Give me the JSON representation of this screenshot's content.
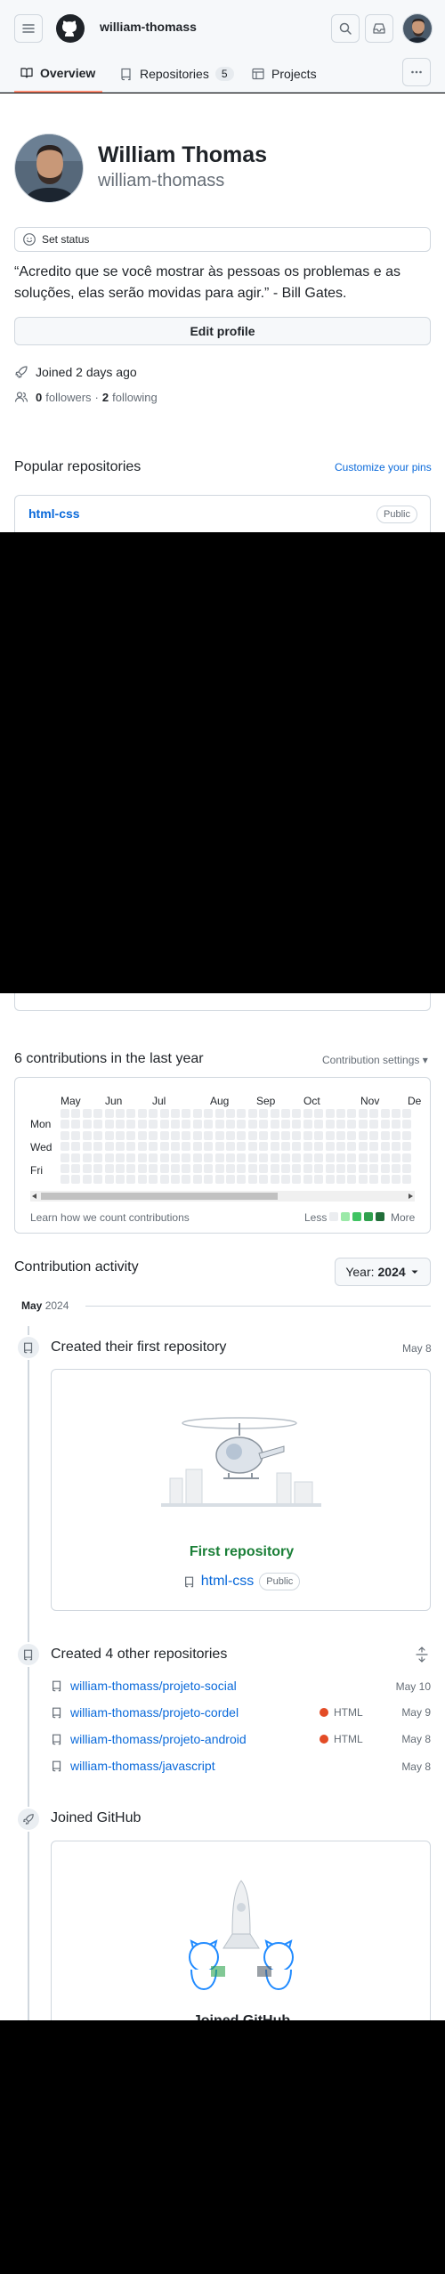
{
  "header": {
    "username": "william-thomass",
    "icons": {
      "menu": "hamburger-icon",
      "logo": "github-mark-icon",
      "search": "search-icon",
      "inbox": "inbox-icon"
    }
  },
  "tabs": [
    {
      "label": "Overview",
      "icon": "book-icon",
      "active": true
    },
    {
      "label": "Repositories",
      "icon": "repo-icon",
      "count": "5"
    },
    {
      "label": "Projects",
      "icon": "table-icon"
    }
  ],
  "profile": {
    "name": "William Thomas",
    "login": "william-thomass",
    "status": "Set status",
    "bio": "“Acredito que se você mostrar às pessoas os problemas e as soluções, elas serão movidas para agir.” - Bill Gates.",
    "edit_button": "Edit profile",
    "joined": "Joined 2 days ago",
    "followers_count": "0",
    "followers_label": "followers",
    "separator": "·",
    "following_count": "2",
    "following_label": "following"
  },
  "popular": {
    "title": "Popular repositories",
    "customize": "Customize your pins",
    "repo_name": "html-css",
    "repo_badge": "Public"
  },
  "contributions": {
    "title": "6 contributions in the last year",
    "settings": "Contribution settings ▾",
    "months": [
      "May",
      "Jun",
      "Jul",
      "Aug",
      "Sep",
      "Oct",
      "Nov",
      "De"
    ],
    "days": [
      "Mon",
      "Wed",
      "Fri"
    ],
    "learn": "Learn how we count contributions",
    "less": "Less",
    "more": "More",
    "legend_colors": [
      "#ebedf0",
      "#9be9a8",
      "#40c463",
      "#30a14e",
      "#216e39"
    ]
  },
  "activity": {
    "title": "Contribution activity",
    "year_prefix": "Year:",
    "year": "2024",
    "month_label": "May",
    "month_year": "2024",
    "first_repo": {
      "title": "Created their first repository",
      "date": "May 8",
      "card_title": "First repository",
      "repo_name": "html-css",
      "badge": "Public"
    },
    "other_repos": {
      "title": "Created 4 other repositories",
      "items": [
        {
          "name": "william-thomass/projeto-social",
          "lang": "",
          "date": "May 10"
        },
        {
          "name": "william-thomass/projeto-cordel",
          "lang": "HTML",
          "date": "May 9"
        },
        {
          "name": "william-thomass/projeto-android",
          "lang": "HTML",
          "date": "May 8"
        },
        {
          "name": "william-thomass/javascript",
          "lang": "",
          "date": "May 8"
        }
      ]
    },
    "joined": {
      "title": "Joined GitHub",
      "card_title": "Joined GitHub"
    }
  },
  "colors": {
    "accent": "#0969da",
    "tab_underline": "#fd8c73",
    "success": "#1a7f37",
    "html_lang": "#e34c26"
  }
}
